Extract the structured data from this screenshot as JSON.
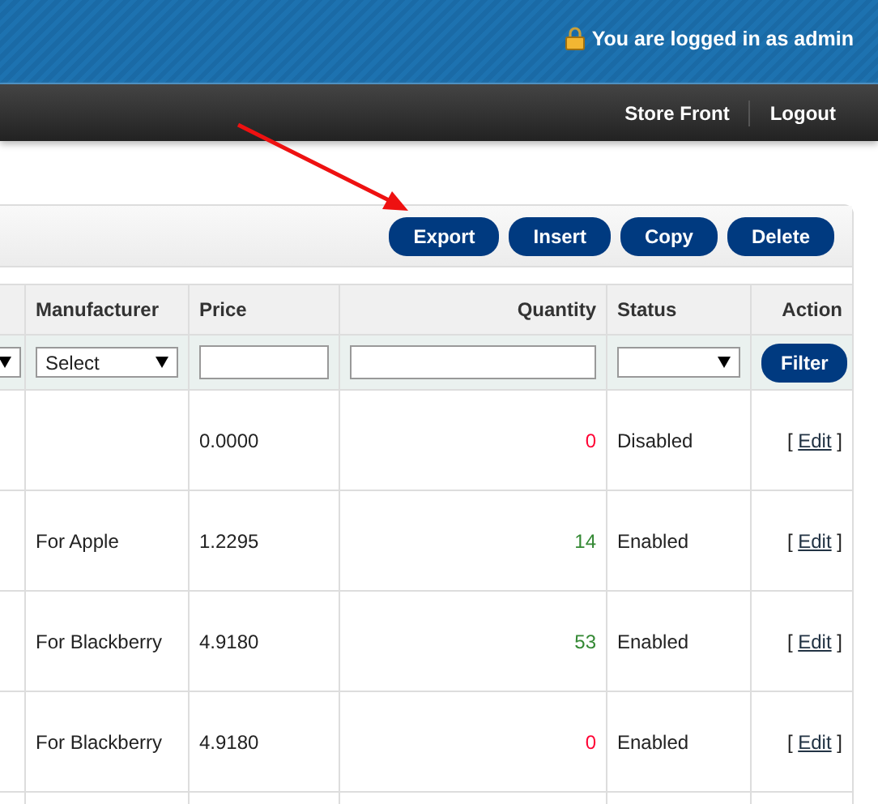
{
  "header": {
    "login_text": "You are logged in as admin"
  },
  "nav": {
    "items": [
      "Store Front",
      "Logout"
    ]
  },
  "toolbar": {
    "buttons": [
      "Export",
      "Insert",
      "Copy",
      "Delete"
    ]
  },
  "table": {
    "columns": [
      "Manufacturer",
      "Price",
      "Quantity",
      "Status",
      "Action"
    ],
    "filters": {
      "manufacturer": "Select",
      "button": "Filter"
    },
    "rows": [
      {
        "manufacturer": "",
        "price": "0.0000",
        "quantity": "0",
        "color": "#ff0033",
        "status": "Disabled",
        "action": {
          "open": "[",
          "link": "Edit",
          "close": "]"
        }
      },
      {
        "manufacturer": "For Apple",
        "price": "1.2295",
        "quantity": "14",
        "color": "#338833",
        "status": "Enabled",
        "action": {
          "open": "[",
          "link": "Edit",
          "close": "]"
        }
      },
      {
        "manufacturer": "For Blackberry",
        "price": "4.9180",
        "quantity": "53",
        "color": "#338833",
        "status": "Enabled",
        "action": {
          "open": "[",
          "link": "Edit",
          "close": "]"
        }
      },
      {
        "manufacturer": "For Blackberry",
        "price": "4.9180",
        "quantity": "0",
        "color": "#ff0033",
        "status": "Enabled",
        "action": {
          "open": "[",
          "link": "Edit",
          "close": "]"
        }
      }
    ]
  }
}
